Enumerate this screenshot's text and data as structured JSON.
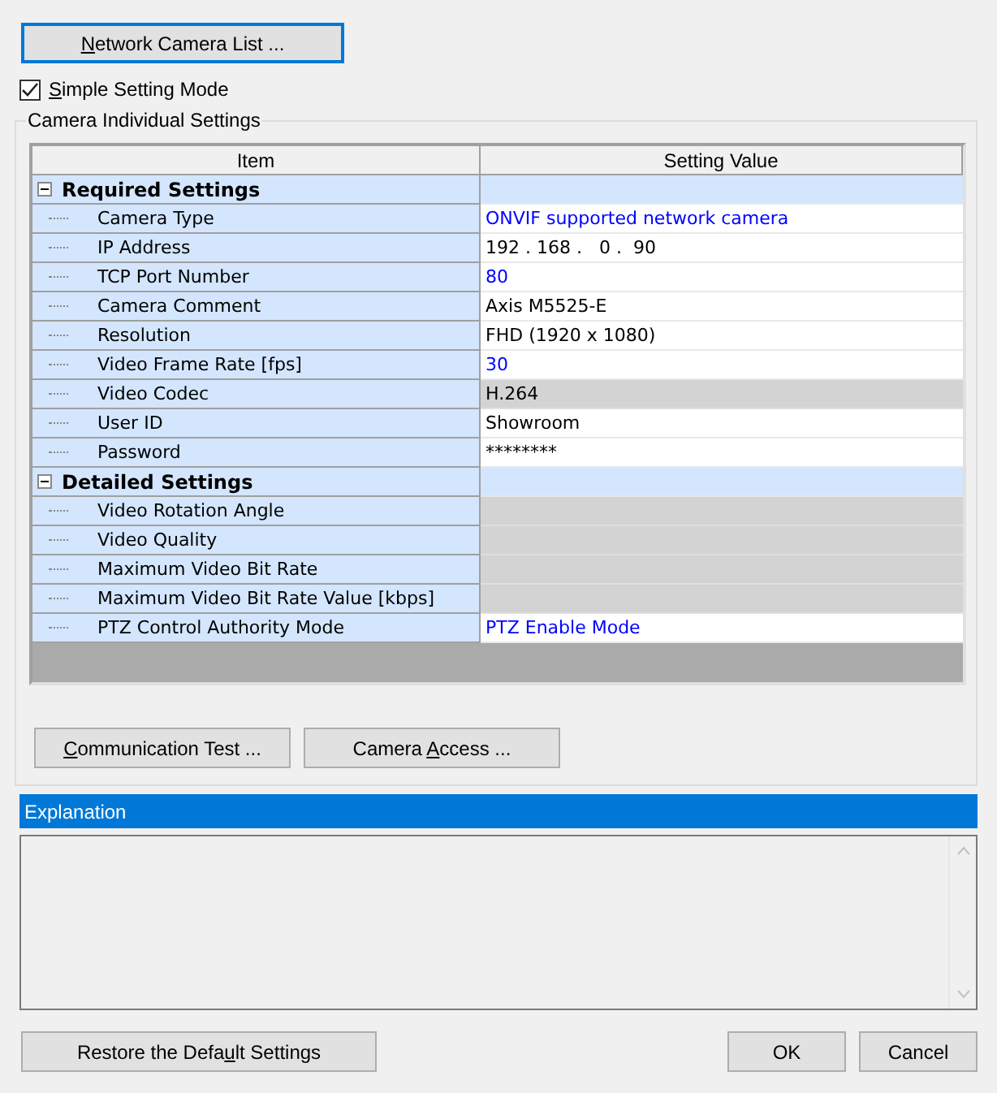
{
  "top_button": {
    "label": "Network Camera List ...",
    "focused": true
  },
  "simple_mode": {
    "label": "Simple Setting Mode",
    "checked": true
  },
  "group_title": "Camera Individual Settings",
  "table": {
    "columns": [
      "Item",
      "Setting Value"
    ],
    "groups": [
      {
        "label": "Required Settings",
        "expanded": true,
        "children": [
          {
            "item": "Camera Type",
            "value": "ONVIF supported network camera",
            "kind": "changed"
          },
          {
            "item": "IP Address",
            "value": "192 . 168 .   0 .  90",
            "kind": "plain"
          },
          {
            "item": "TCP Port Number",
            "value": "80",
            "kind": "changed"
          },
          {
            "item": "Camera Comment",
            "value": "Axis M5525-E",
            "kind": "plain"
          },
          {
            "item": "Resolution",
            "value": "FHD (1920 x 1080)",
            "kind": "plain"
          },
          {
            "item": "Video Frame Rate [fps]",
            "value": "30",
            "kind": "changed"
          },
          {
            "item": "Video Codec",
            "value": "H.264",
            "kind": "disabled"
          },
          {
            "item": "User ID",
            "value": "Showroom",
            "kind": "plain"
          },
          {
            "item": "Password",
            "value": "********",
            "kind": "plain"
          }
        ]
      },
      {
        "label": "Detailed Settings",
        "expanded": true,
        "children": [
          {
            "item": "Video Rotation Angle",
            "kind": "disabled"
          },
          {
            "item": "Video Quality",
            "kind": "disabled"
          },
          {
            "item": "Maximum Video Bit Rate",
            "kind": "disabled"
          },
          {
            "item": "Maximum Video Bit Rate Value [kbps]",
            "kind": "disabled"
          },
          {
            "item": "PTZ Control Authority Mode",
            "value": "PTZ Enable Mode",
            "kind": "changed"
          }
        ]
      }
    ]
  },
  "group_buttons": [
    {
      "label": "Communication Test ..."
    },
    {
      "label": "Camera Access ..."
    }
  ],
  "explanation": {
    "title": "Explanation"
  },
  "bottom_buttons": [
    {
      "label": "Restore the Default Settings"
    },
    {
      "label": "OK"
    },
    {
      "label": "Cancel"
    }
  ]
}
